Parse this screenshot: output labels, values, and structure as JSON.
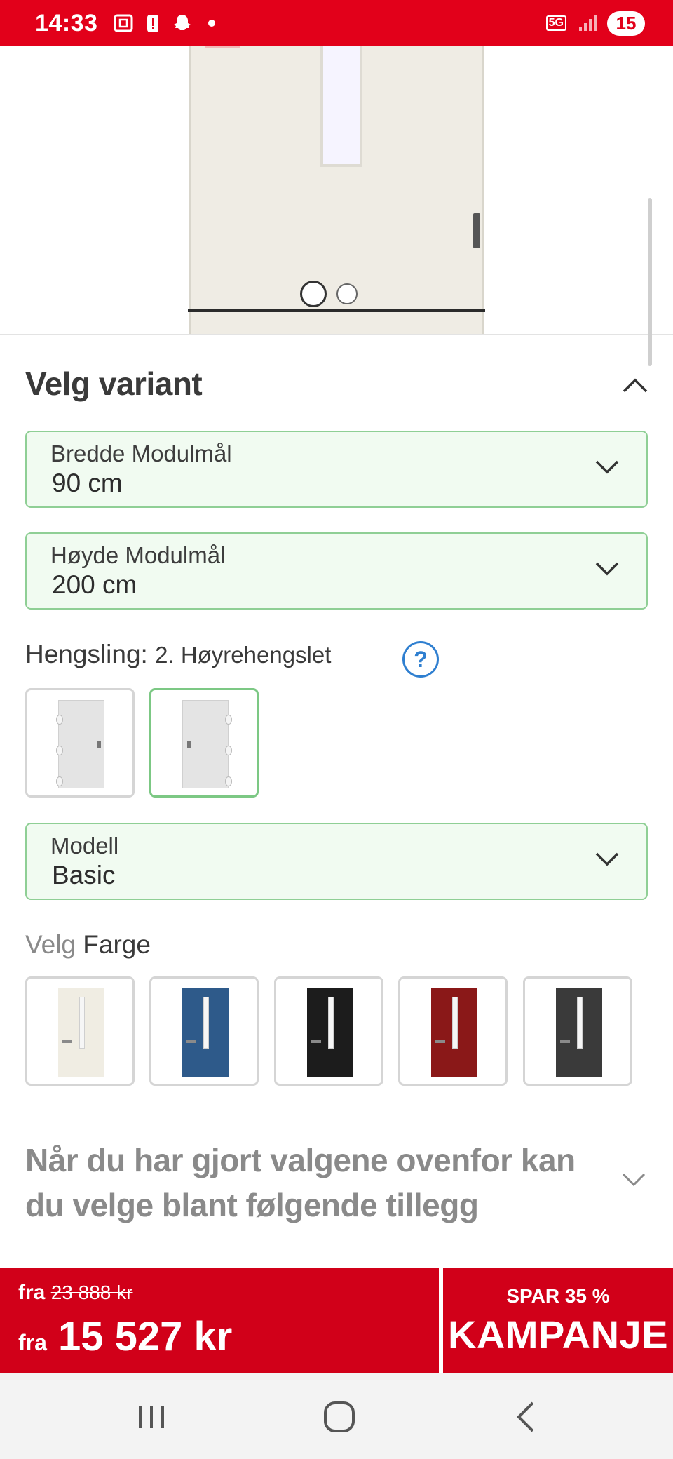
{
  "status_bar": {
    "time": "14:33",
    "network": "5G",
    "battery": "15",
    "icons": [
      "screenshot-icon",
      "alert-icon",
      "snapchat-icon",
      "dot-icon",
      "signal-icon"
    ]
  },
  "gallery": {
    "dots": 2,
    "active_index": 0
  },
  "variant": {
    "title": "Velg variant",
    "width": {
      "label": "Bredde Modulmål",
      "value": "90 cm"
    },
    "height": {
      "label": "Høyde Modulmål",
      "value": "200 cm"
    },
    "hinge": {
      "label": "Hengsling:",
      "value": "2. Høyrehengslet",
      "help": "?",
      "options": [
        {
          "name": "venstrehengslet"
        },
        {
          "name": "høyrehengslet"
        }
      ],
      "selected_index": 1
    },
    "model": {
      "label": "Modell",
      "value": "Basic"
    },
    "color": {
      "label_prefix": "Velg",
      "label": "Farge",
      "options": [
        {
          "color": "#f0ede3"
        },
        {
          "color": "#2e5a8a"
        },
        {
          "color": "#1c1c1c"
        },
        {
          "color": "#8a1818"
        },
        {
          "color": "#3a3a3a"
        }
      ]
    }
  },
  "addons": {
    "text": "Når du har gjort valgene ovenfor kan du velge blant følgende tillegg"
  },
  "price": {
    "old_prefix": "fra",
    "old_price": "23 888 kr",
    "new_prefix": "fra",
    "new_price": "15 527 kr",
    "discount": "SPAR 35 %",
    "campaign": "KAMPANJE"
  },
  "colors": {
    "brand_red": "#e2001a",
    "price_red": "#d10019",
    "select_bg": "#f1fbf1",
    "select_border": "#8fcf95",
    "help_blue": "#2f7fd0"
  }
}
